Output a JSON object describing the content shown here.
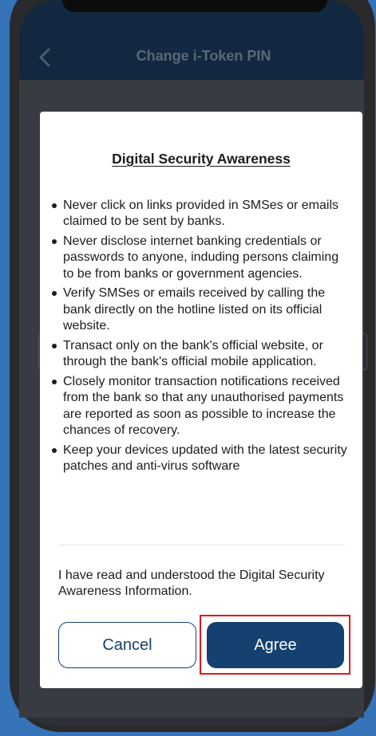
{
  "header": {
    "title": "Change i-Token PIN",
    "back_icon": "chevron-left-icon"
  },
  "dialog": {
    "title": "Digital Security Awareness",
    "bullets": [
      "Never click on links provided in SMSes or emails claimed to be sent by banks.",
      "Never disclose internet banking credentials or passwords to anyone, induding persons claiming to be from banks or government agencies.",
      "Verify SMSes or emails received by calling the bank directly on the hotline listed on its official website.",
      "Transact only on the bank's official website, or through the bank's official mobile application.",
      "Closely monitor transaction notifications received from the bank so that any unauthorised payments are reported as soon as possible to increase the chances of recovery.",
      "Keep your devices updated with the latest security patches and anti-virus software"
    ],
    "confirmation": "I have read and understood the Digital Security Awareness Information.",
    "cancel_label": "Cancel",
    "agree_label": "Agree"
  },
  "colors": {
    "background": "#3574b8",
    "header": "#112840",
    "primary": "#14416f",
    "highlight": "#e0171f"
  }
}
